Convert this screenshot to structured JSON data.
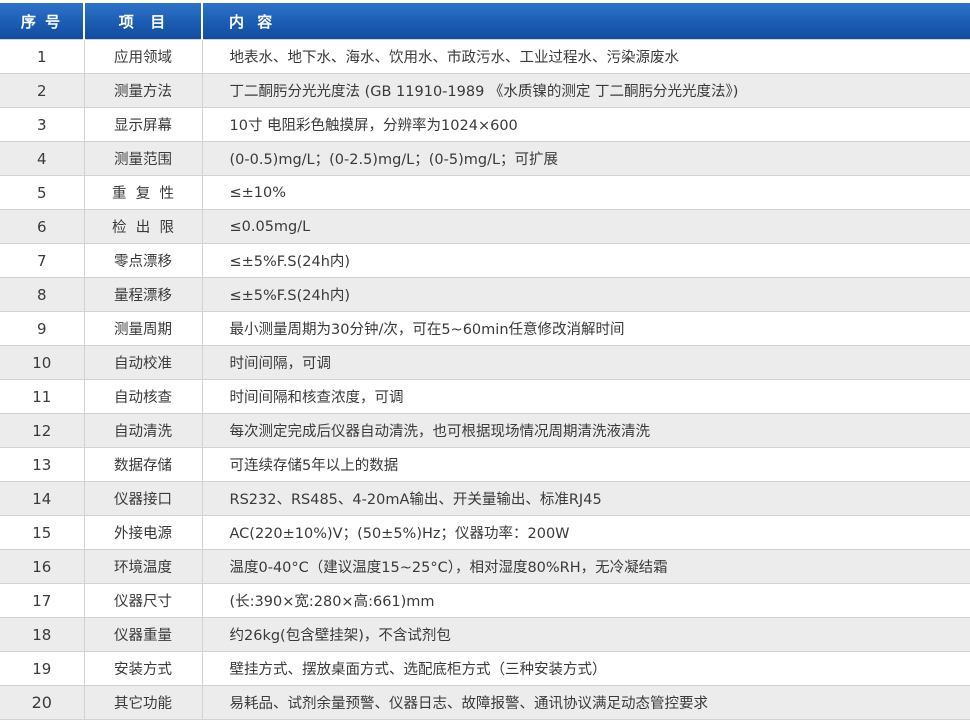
{
  "header": {
    "no": "序 号",
    "item": "项  目",
    "content": "内 容"
  },
  "rows": [
    {
      "no": "1",
      "item": "应用领域",
      "content": "地表水、地下水、海水、饮用水、市政污水、工业过程水、污染源废水"
    },
    {
      "no": "2",
      "item": "测量方法",
      "content": "丁二酮肟分光光度法 (GB 11910-1989 《水质镍的测定 丁二酮肟分光光度法》)"
    },
    {
      "no": "3",
      "item": "显示屏幕",
      "content": "10寸 电阻彩色触摸屏，分辨率为1024×600"
    },
    {
      "no": "4",
      "item": "测量范围",
      "content": "(0-0.5)mg/L；(0-2.5)mg/L；(0-5)mg/L；可扩展"
    },
    {
      "no": "5",
      "item": "重  复  性",
      "content": "≤±10%"
    },
    {
      "no": "6",
      "item": "检  出  限",
      "content": "≤0.05mg/L"
    },
    {
      "no": "7",
      "item": "零点漂移",
      "content": "≤±5%F.S(24h内)"
    },
    {
      "no": "8",
      "item": "量程漂移",
      "content": "≤±5%F.S(24h内)"
    },
    {
      "no": "9",
      "item": "测量周期",
      "content": "最小测量周期为30分钟/次，可在5~60min任意修改消解时间"
    },
    {
      "no": "10",
      "item": "自动校准",
      "content": "时间间隔，可调"
    },
    {
      "no": "11",
      "item": "自动核查",
      "content": "时间间隔和核查浓度，可调"
    },
    {
      "no": "12",
      "item": "自动清洗",
      "content": "每次测定完成后仪器自动清洗，也可根据现场情况周期清洗液清洗"
    },
    {
      "no": "13",
      "item": "数据存储",
      "content": "可连续存储5年以上的数据"
    },
    {
      "no": "14",
      "item": "仪器接口",
      "content": "RS232、RS485、4-20mA输出、开关量输出、标准RJ45"
    },
    {
      "no": "15",
      "item": "外接电源",
      "content": "AC(220±10%)V；(50±5%)Hz；仪器功率：200W"
    },
    {
      "no": "16",
      "item": "环境温度",
      "content": "温度0-40°C（建议温度15~25°C），相对湿度80%RH，无冷凝结霜"
    },
    {
      "no": "17",
      "item": "仪器尺寸",
      "content": "(长:390×宽:280×高:661)mm"
    },
    {
      "no": "18",
      "item": "仪器重量",
      "content": "约26kg(包含壁挂架)，不含试剂包"
    },
    {
      "no": "19",
      "item": "安装方式",
      "content": "壁挂方式、摆放桌面方式、选配底柜方式（三种安装方式）"
    },
    {
      "no": "20",
      "item": "其它功能",
      "content": "易耗品、试剂余量预警、仪器日志、故障报警、通讯协议满足动态管控要求"
    }
  ]
}
